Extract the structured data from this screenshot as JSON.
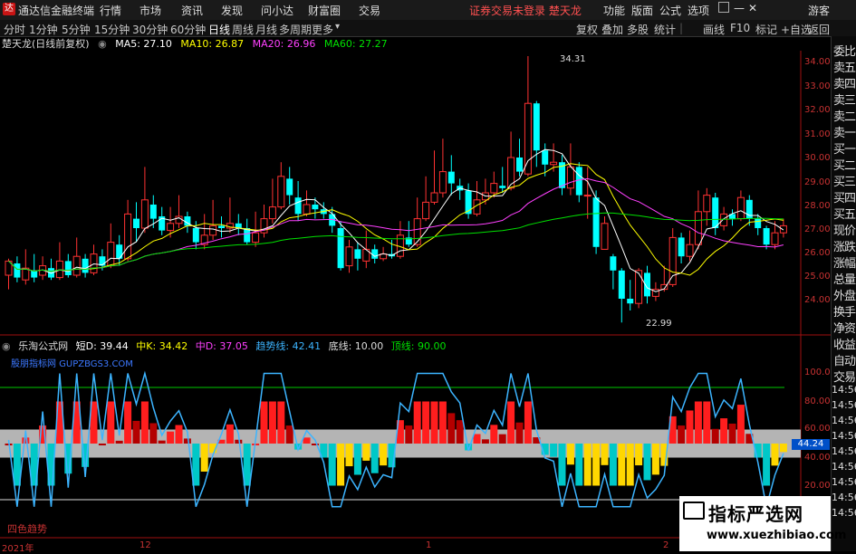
{
  "titlebar": {
    "logo": "达",
    "app_name": "通达信金融终端",
    "menus": [
      "行情",
      "市场",
      "资讯",
      "发现",
      "问小达",
      "财富圈",
      "交易"
    ],
    "warning": "证券交易未登录  楚天龙",
    "right_menus": [
      "功能",
      "版面",
      "公式",
      "选项"
    ],
    "guest": "游客"
  },
  "toolbar": {
    "periods": [
      "分时",
      "1分钟",
      "5分钟",
      "15分钟",
      "30分钟",
      "60分钟",
      "日线",
      "周线",
      "月线",
      "多周期",
      "更多"
    ],
    "active_period": "日线",
    "right_buttons": [
      "复权",
      "叠加",
      "多股",
      "统计",
      "画线",
      "F10",
      "标记",
      "+自选",
      "返回"
    ]
  },
  "stock": {
    "name": "楚天龙(日线前复权)",
    "ma5": "MA5: 27.10",
    "ma10": "MA10: 26.87",
    "ma20": "MA20: 26.96",
    "ma60": "MA60: 27.27",
    "high_label": "34.31",
    "low_label": "22.99"
  },
  "colors": {
    "up": "#ff3232",
    "down": "#00ffff",
    "ma5": "#ffffff",
    "ma10": "#ffff00",
    "ma20": "#ff40ff",
    "ma60": "#00e000",
    "axis": "#c83232"
  },
  "price_axis": [
    "34.00",
    "33.00",
    "32.00",
    "31.00",
    "30.00",
    "29.00",
    "28.00",
    "27.00",
    "26.00",
    "25.00",
    "24.00"
  ],
  "indicator": {
    "name": "乐淘公式网",
    "short": "短D: 39.44",
    "mid_k": "中K: 34.42",
    "mid_d": "中D: 37.05",
    "trend": "趋势线: 42.41",
    "bottom": "底线: 10.00",
    "top": "顶线: 90.00",
    "overlay_text": "股朋指标网 GUPZBGS3.COM",
    "current_value": "44.24",
    "footer": "四色趋势",
    "axis": [
      "100.0",
      "80.00",
      "60.00",
      "40.00",
      "20.00"
    ]
  },
  "right_panel": {
    "items": [
      "委比",
      "卖五",
      "卖四",
      "卖三",
      "卖二",
      "卖一",
      "买一",
      "买二",
      "买三",
      "买四",
      "买五",
      "现价",
      "涨跌",
      "涨幅",
      "总量",
      "外盘",
      "换手",
      "净资",
      "收益",
      "自动",
      "交易"
    ],
    "times": [
      "14:56",
      "14:56",
      "14:56",
      "14:56",
      "14:56",
      "14:56",
      "14:56",
      "14:56",
      "14:56"
    ]
  },
  "x_axis": [
    "2021年",
    "12",
    "1",
    "2"
  ],
  "watermark": {
    "line1": "指标严选网",
    "line2": "www.xuezhibiao.com"
  },
  "chart_data": {
    "type": "candlestick",
    "ylim": [
      23.5,
      34.8
    ],
    "candles": [
      [
        25.0,
        25.6,
        25.7,
        24.4
      ],
      [
        25.5,
        24.9,
        25.8,
        24.7
      ],
      [
        24.8,
        25.3,
        26.1,
        24.6
      ],
      [
        25.2,
        24.9,
        25.9,
        24.7
      ],
      [
        25.0,
        25.4,
        25.8,
        24.8
      ],
      [
        25.3,
        24.9,
        25.7,
        24.8
      ],
      [
        24.9,
        25.6,
        26.4,
        24.8
      ],
      [
        25.6,
        25.0,
        25.9,
        24.9
      ],
      [
        25.0,
        25.8,
        26.6,
        24.9
      ],
      [
        25.7,
        25.1,
        25.9,
        24.9
      ],
      [
        25.1,
        25.9,
        26.3,
        25.0
      ],
      [
        25.8,
        25.4,
        26.1,
        25.2
      ],
      [
        25.4,
        26.4,
        27.2,
        25.3
      ],
      [
        26.3,
        25.7,
        26.7,
        25.4
      ],
      [
        25.7,
        27.6,
        28.2,
        25.6
      ],
      [
        27.4,
        27.0,
        28.1,
        26.4
      ],
      [
        27.0,
        28.2,
        29.6,
        26.8
      ],
      [
        28.0,
        27.4,
        28.4,
        27.0
      ],
      [
        27.5,
        26.9,
        27.9,
        26.7
      ],
      [
        26.9,
        27.2,
        27.9,
        26.6
      ],
      [
        27.2,
        27.5,
        28.4,
        27.0
      ],
      [
        27.5,
        27.1,
        27.7,
        26.8
      ],
      [
        27.0,
        26.4,
        27.3,
        26.1
      ],
      [
        26.3,
        26.7,
        27.6,
        26.1
      ],
      [
        26.7,
        27.1,
        28.2,
        26.5
      ],
      [
        27.1,
        27.0,
        27.5,
        26.6
      ],
      [
        27.0,
        27.2,
        28.3,
        26.8
      ],
      [
        27.2,
        27.0,
        27.6,
        26.7
      ],
      [
        27.0,
        26.4,
        27.4,
        26.3
      ],
      [
        26.4,
        26.8,
        27.7,
        26.2
      ],
      [
        26.8,
        27.4,
        28.0,
        26.6
      ],
      [
        27.4,
        27.9,
        29.1,
        27.2
      ],
      [
        27.9,
        29.2,
        29.8,
        27.8
      ],
      [
        29.1,
        28.4,
        29.6,
        28.0
      ],
      [
        28.3,
        27.6,
        29.0,
        27.3
      ],
      [
        27.6,
        28.0,
        28.6,
        27.5
      ],
      [
        28.0,
        27.8,
        28.3,
        27.4
      ],
      [
        27.8,
        27.6,
        28.1,
        27.4
      ],
      [
        27.6,
        27.1,
        27.9,
        26.8
      ],
      [
        27.0,
        25.3,
        27.3,
        25.2
      ],
      [
        25.4,
        26.2,
        26.5,
        25.1
      ],
      [
        26.1,
        25.7,
        26.4,
        25.2
      ],
      [
        25.6,
        26.1,
        26.9,
        25.3
      ],
      [
        26.1,
        25.7,
        26.3,
        25.5
      ],
      [
        25.7,
        25.9,
        26.2,
        25.6
      ],
      [
        25.9,
        25.8,
        26.5,
        25.7
      ],
      [
        25.8,
        26.7,
        27.3,
        25.7
      ],
      [
        26.6,
        26.3,
        27.3,
        26.2
      ],
      [
        26.3,
        27.4,
        28.3,
        26.2
      ],
      [
        27.4,
        28.1,
        29.2,
        27.3
      ],
      [
        28.1,
        28.5,
        30.3,
        28.0
      ],
      [
        28.5,
        29.4,
        30.8,
        28.3
      ],
      [
        29.4,
        28.9,
        30.1,
        28.4
      ],
      [
        28.8,
        28.6,
        29.1,
        28.2
      ],
      [
        28.6,
        27.6,
        28.9,
        27.4
      ],
      [
        27.6,
        28.2,
        29.0,
        27.5
      ],
      [
        28.2,
        28.5,
        29.1,
        28.0
      ],
      [
        28.5,
        28.9,
        29.4,
        28.3
      ],
      [
        28.8,
        28.7,
        29.6,
        28.5
      ],
      [
        28.7,
        30.0,
        31.1,
        28.6
      ],
      [
        30.0,
        29.4,
        30.8,
        29.2
      ],
      [
        29.3,
        32.3,
        34.31,
        29.2
      ],
      [
        32.3,
        30.3,
        32.4,
        29.6
      ],
      [
        30.3,
        29.7,
        30.6,
        29.2
      ],
      [
        29.7,
        29.8,
        30.6,
        29.4
      ],
      [
        29.8,
        28.7,
        30.1,
        28.4
      ],
      [
        28.7,
        29.6,
        30.6,
        28.4
      ],
      [
        29.6,
        28.4,
        29.8,
        28.1
      ],
      [
        28.4,
        28.4,
        29.6,
        27.4
      ],
      [
        28.3,
        26.2,
        28.6,
        25.9
      ],
      [
        26.1,
        27.2,
        27.5,
        26.1
      ],
      [
        25.8,
        25.2,
        25.9,
        24.4
      ],
      [
        25.2,
        24.0,
        25.3,
        22.99
      ],
      [
        24.0,
        23.8,
        24.8,
        23.5
      ],
      [
        23.8,
        25.2,
        25.3,
        23.6
      ],
      [
        25.1,
        24.1,
        25.4,
        23.8
      ],
      [
        24.1,
        24.4,
        24.7,
        23.9
      ],
      [
        24.4,
        24.6,
        25.4,
        24.3
      ],
      [
        24.6,
        26.6,
        27.0,
        24.5
      ],
      [
        26.6,
        25.8,
        26.8,
        25.5
      ],
      [
        25.8,
        26.3,
        26.9,
        25.6
      ],
      [
        26.3,
        27.7,
        28.6,
        26.1
      ],
      [
        27.7,
        28.4,
        28.7,
        27.1
      ],
      [
        28.3,
        27.0,
        28.5,
        26.7
      ],
      [
        27.1,
        27.6,
        27.9,
        26.9
      ],
      [
        27.6,
        27.4,
        27.8,
        27.1
      ],
      [
        27.4,
        28.3,
        28.6,
        27.3
      ],
      [
        28.2,
        27.4,
        28.4,
        27.1
      ],
      [
        27.4,
        27.0,
        27.6,
        26.7
      ],
      [
        27.0,
        26.3,
        27.1,
        26.1
      ],
      [
        26.3,
        26.8,
        27.3,
        26.1
      ],
      [
        26.8,
        27.1,
        27.4,
        26.6
      ]
    ]
  }
}
